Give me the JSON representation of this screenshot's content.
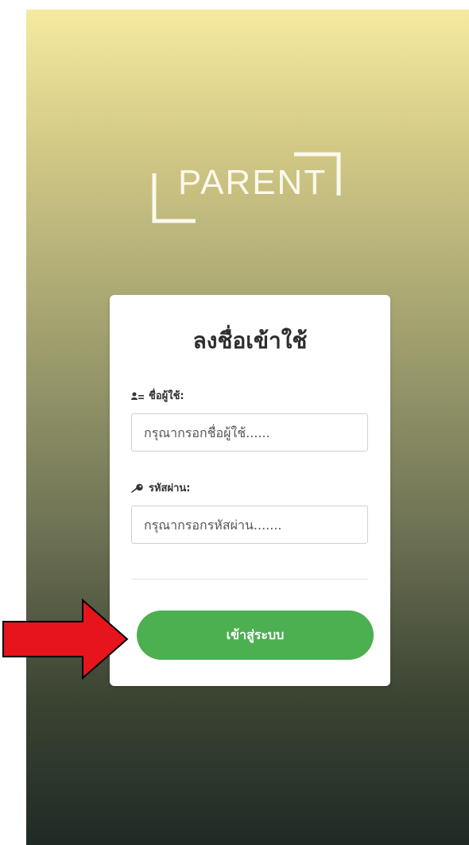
{
  "logo": {
    "text": "PARENT"
  },
  "login": {
    "title": "ลงชื่อเข้าใช้",
    "username_label": "ชื่อผู้ใช้:",
    "username_placeholder": "กรุณากรอกชื่อผู้ใช้......",
    "password_label": "รหัสผ่าน:",
    "password_placeholder": "กรุณากรอกรหัสผ่าน.......",
    "submit_label": "เข้าสู่ระบบ"
  },
  "icons": {
    "username": "user-icon",
    "password": "key-icon",
    "annotation": "red-arrow-icon"
  },
  "colors": {
    "button": "#4caf50",
    "arrow": "#e8141b",
    "gradient_top": "#f6ea9f",
    "gradient_bottom": "#1f2a25"
  }
}
